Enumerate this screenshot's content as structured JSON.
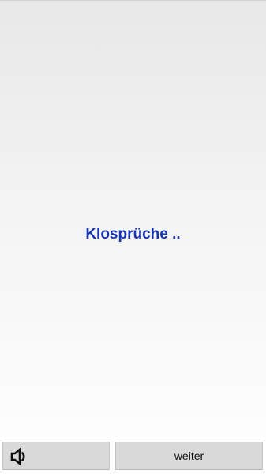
{
  "screen": {
    "title": "Klosprüche .."
  },
  "controls": {
    "sound_icon": "speaker-icon",
    "next_label": "weiter"
  },
  "colors": {
    "title": "#1735b3",
    "button_bg": "#d9d9d9"
  }
}
